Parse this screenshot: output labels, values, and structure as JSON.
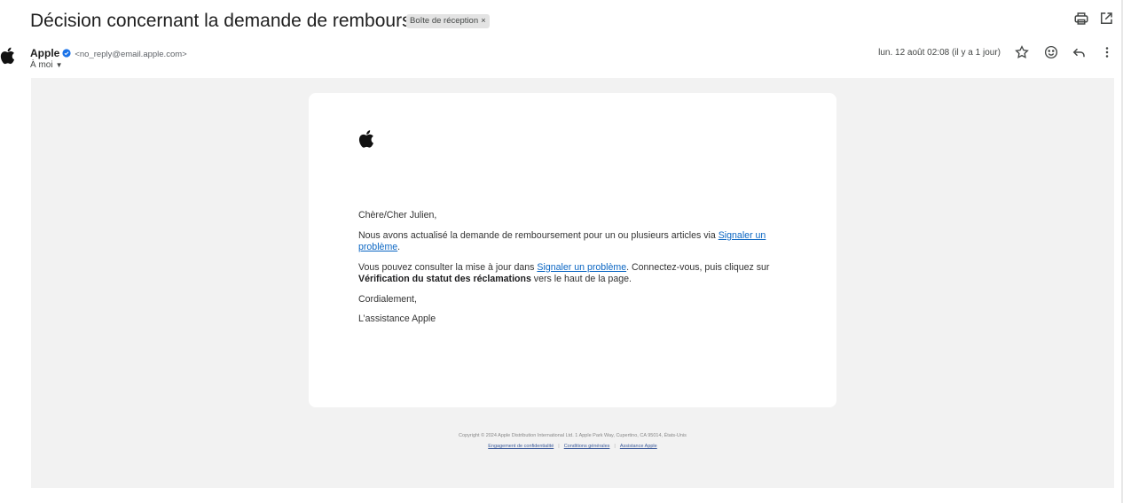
{
  "email": {
    "subject": "Décision concernant la demande de remboursement",
    "label": "Boîte de réception",
    "label_remove": "×",
    "sender": {
      "name": "Apple",
      "email": "<no_reply@email.apple.com>",
      "to": "À moi"
    },
    "date": "lun. 12 août 02:08 (il y a 1 jour)"
  },
  "message": {
    "greeting": "Chère/Cher Julien,",
    "p1_text": "Nous avons actualisé la demande de remboursement pour un ou plusieurs articles via ",
    "p1_link": "Signaler un problème",
    "p1_end": ".",
    "p2_text": "Vous pouvez consulter la mise à jour dans ",
    "p2_link": "Signaler un problème",
    "p2_mid": ". Connectez-vous, puis cliquez sur ",
    "p2_bold": "Vérification du statut des réclamations",
    "p2_end": " vers le haut de la page.",
    "closing": "Cordialement,",
    "signature": "L’assistance Apple"
  },
  "footer": {
    "copyright": "Copyright © 2024 Apple Distribution International Ltd.  1 Apple Park Way, Cupertino, CA 95014, États-Unis",
    "links": [
      "Engagement de confidentialité",
      "Conditions générales",
      "Assistance Apple"
    ],
    "separator": "|"
  },
  "icons": {
    "print": "print-icon",
    "open_new_window": "open-in-new-window-icon",
    "star": "star-icon",
    "emoji": "emoji-icon",
    "reply": "reply-icon",
    "more": "more-vertical-icon",
    "verified": "verified-badge-icon",
    "logo": "apple-logo-icon"
  },
  "colors": {
    "link": "#0b66c3",
    "verified": "#1a73e8",
    "mail_background": "#f2f2f2"
  }
}
